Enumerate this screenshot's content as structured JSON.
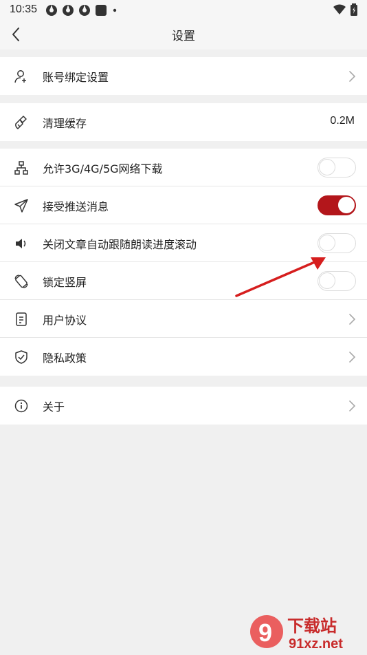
{
  "status_bar": {
    "time": "10:35"
  },
  "nav": {
    "title": "设置"
  },
  "groups": [
    {
      "items": [
        {
          "label": "账号绑定设置",
          "icon": "user-link-icon",
          "control": "chevron"
        }
      ]
    },
    {
      "items": [
        {
          "label": "清理缓存",
          "icon": "broom-icon",
          "control": "value",
          "value": "0.2M"
        }
      ]
    },
    {
      "items": [
        {
          "label": "允许3G/4G/5G网络下载",
          "icon": "network-tree-icon",
          "control": "toggle",
          "on": false
        },
        {
          "label": "接受推送消息",
          "icon": "paper-plane-icon",
          "control": "toggle",
          "on": true
        },
        {
          "label": "关闭文章自动跟随朗读进度滚动",
          "icon": "speaker-icon",
          "control": "toggle",
          "on": false
        },
        {
          "label": "锁定竖屏",
          "icon": "screen-rotate-icon",
          "control": "toggle",
          "on": false
        },
        {
          "label": "用户协议",
          "icon": "document-icon",
          "control": "chevron"
        },
        {
          "label": "隐私政策",
          "icon": "shield-check-icon",
          "control": "chevron"
        }
      ]
    },
    {
      "items": [
        {
          "label": "关于",
          "icon": "info-icon",
          "control": "chevron"
        }
      ]
    }
  ],
  "colors": {
    "accent": "#b3161b",
    "annotation_arrow": "#d61e1e"
  },
  "watermark": {
    "brand": "下载站",
    "domain": "91xz.net",
    "logo_text": "9"
  }
}
